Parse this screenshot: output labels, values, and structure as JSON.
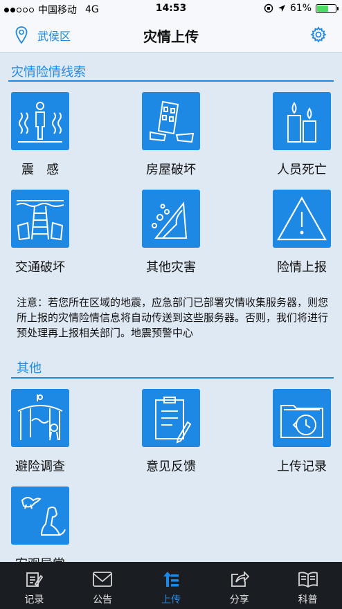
{
  "status": {
    "carrier": "中国移动",
    "network": "4G",
    "time": "14:53",
    "battery": "61%",
    "battery_level": 0.61,
    "signal_bars": 2
  },
  "nav": {
    "location": "武侯区",
    "title": "灾情上传",
    "location_icon": "map-pin-icon",
    "settings_icon": "gear-icon"
  },
  "section1": {
    "title": "灾情险情线索",
    "tiles": [
      {
        "label": "震　感",
        "icon": "shaking-person-icon"
      },
      {
        "label": "房屋破坏",
        "icon": "collapsed-building-icon"
      },
      {
        "label": "人员死亡",
        "icon": "candles-icon"
      },
      {
        "label": "交通破坏",
        "icon": "broken-bridge-icon"
      },
      {
        "label": "其他灾害",
        "icon": "landslide-icon"
      },
      {
        "label": "险情上报",
        "icon": "warning-triangle-icon"
      }
    ]
  },
  "notice": "注意：若您所在区域的地震，应急部门已部署灾情收集服务器，则您所上报的灾情险情信息将自动传送到这些服务器。否则，我们将进行预处理再上报相关部门。地震预警中心",
  "section2": {
    "title": "其他",
    "tiles": [
      {
        "label": "避险调查",
        "icon": "shelter-icon"
      },
      {
        "label": "意见反馈",
        "icon": "clipboard-icon"
      },
      {
        "label": "上传记录",
        "icon": "folder-history-icon"
      },
      {
        "label": "宏观异常",
        "icon": "animals-icon"
      }
    ]
  },
  "tabs": [
    {
      "label": "记录",
      "icon": "edit-icon",
      "active": false
    },
    {
      "label": "公告",
      "icon": "mail-icon",
      "active": false
    },
    {
      "label": "上传",
      "icon": "upload-icon",
      "active": true
    },
    {
      "label": "分享",
      "icon": "share-icon",
      "active": false
    },
    {
      "label": "科普",
      "icon": "book-icon",
      "active": false
    }
  ],
  "colors": {
    "accent": "#1e88e5",
    "background": "#dfe9f4",
    "tabbar": "#1a1d22"
  }
}
